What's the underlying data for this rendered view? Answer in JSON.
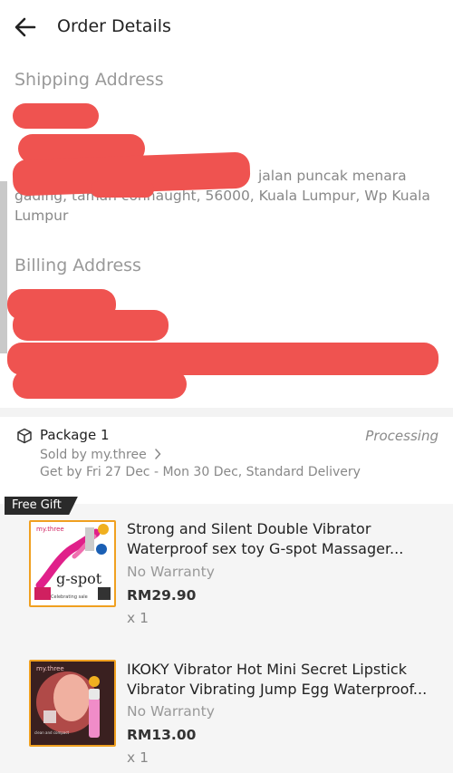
{
  "header": {
    "title": "Order Details"
  },
  "shipping": {
    "title": "Shipping Address",
    "line1_visible": "jalan puncak menara",
    "line2_visible": "gading, taman connaught, 56000, Kuala Lumpur, Wp Kuala",
    "line3_visible": "Lumpur"
  },
  "billing": {
    "title": "Billing Address"
  },
  "package": {
    "title": "Package 1",
    "status": "Processing",
    "seller": "Sold by my.three",
    "delivery": "Get by Fri 27 Dec - Mon 30 Dec, Standard Delivery"
  },
  "gift_tag": "Free Gift",
  "items": [
    {
      "name_line1": "Strong and Silent Double Vibrator",
      "name_line2": "Waterproof sex toy G-spot Massager...",
      "warranty": "No Warranty",
      "price": "RM29.90",
      "qty": "x 1"
    },
    {
      "name_line1": "IKOKY Vibrator Hot Mini Secret Lipstick",
      "name_line2": "Vibrator Vibrating Jump Egg Waterproof...",
      "warranty": "No Warranty",
      "price": "RM13.00",
      "qty": "x 1"
    }
  ],
  "colors": {
    "redaction": "#ef5350",
    "tag_bg": "#2a2a2a",
    "thumb_border": "#f0a020"
  },
  "icons": [
    "back-arrow-icon",
    "package-icon",
    "chevron-right-icon"
  ]
}
